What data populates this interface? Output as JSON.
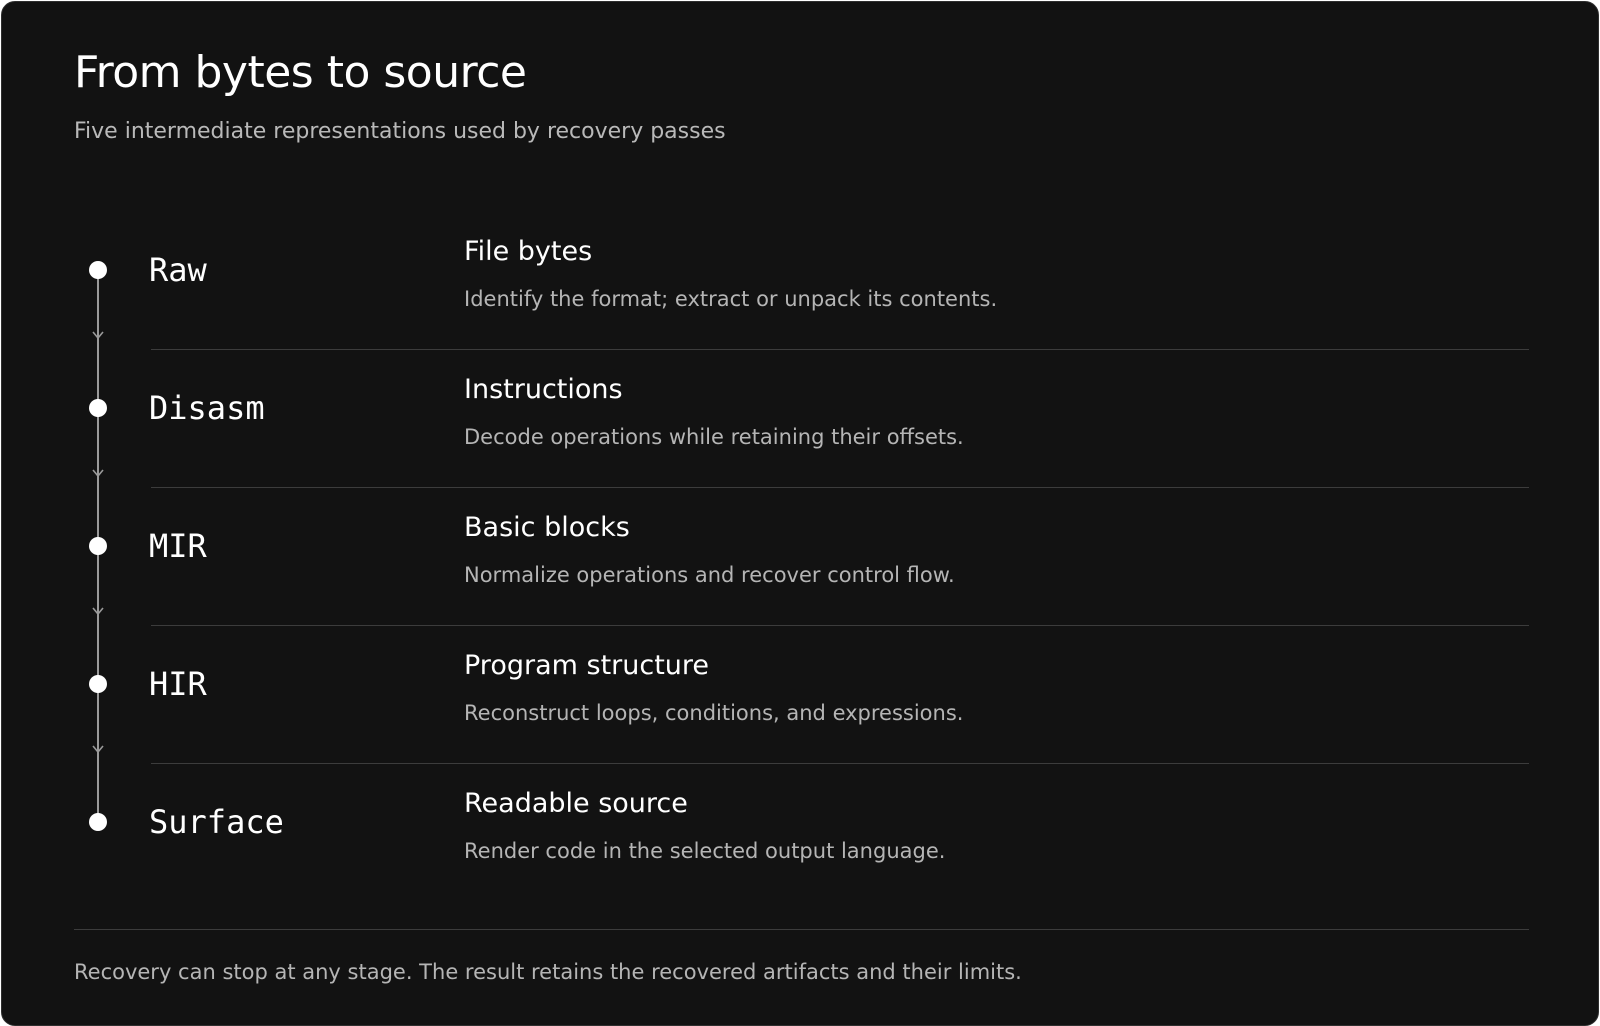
{
  "header": {
    "title": "From bytes to source",
    "subtitle": "Five intermediate representations used by recovery passes"
  },
  "stages": [
    {
      "name": "Raw",
      "title": "File bytes",
      "description": "Identify the format; extract or unpack its contents."
    },
    {
      "name": "Disasm",
      "title": "Instructions",
      "description": "Decode operations while retaining their offsets."
    },
    {
      "name": "MIR",
      "title": "Basic blocks",
      "description": "Normalize operations and recover control flow."
    },
    {
      "name": "HIR",
      "title": "Program structure",
      "description": "Reconstruct loops, conditions, and expressions."
    },
    {
      "name": "Surface",
      "title": "Readable source",
      "description": "Render code in the selected output language."
    }
  ],
  "footer": {
    "note": "Recovery can stop at any stage. The result retains the recovered artifacts and their limits."
  },
  "colors": {
    "background": "#121212",
    "text": "#ffffff",
    "muted": "#b5b5b5",
    "divider": "#3c3c3c",
    "connector": "#9a9a9a"
  }
}
